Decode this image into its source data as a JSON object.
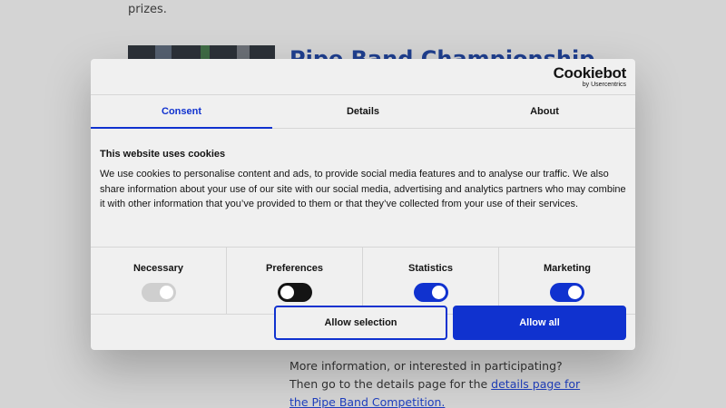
{
  "background": {
    "prizes_text": "prizes.",
    "article_title": "Pipe Band Championship",
    "more_info_text": "More information, or interested in participating? Then go to the details page for the ",
    "more_info_link": "details page for the Pipe Band Competition."
  },
  "dialog": {
    "logo": {
      "main": "Cookiebot",
      "sub": "by Usercentrics"
    },
    "tabs": [
      {
        "label": "Consent",
        "active": true
      },
      {
        "label": "Details",
        "active": false
      },
      {
        "label": "About",
        "active": false
      }
    ],
    "content": {
      "title": "This website uses cookies",
      "text": "We use cookies to personalise content and ads, to provide social media features and to analyse our traffic. We also share information about your use of our site with our social media, advertising and analytics partners who may combine it with other information that you’ve provided to them or that they’ve collected from your use of their services."
    },
    "toggles": [
      {
        "label": "Necessary",
        "state": "on",
        "disabled": true
      },
      {
        "label": "Preferences",
        "state": "off",
        "disabled": false
      },
      {
        "label": "Statistics",
        "state": "on",
        "disabled": false
      },
      {
        "label": "Marketing",
        "state": "on",
        "disabled": false
      }
    ],
    "buttons": {
      "allow_selection": "Allow selection",
      "allow_all": "Allow all"
    }
  },
  "colors": {
    "accent": "#1032cf",
    "dialog_bg": "#f0f0f0",
    "text": "#141414"
  }
}
